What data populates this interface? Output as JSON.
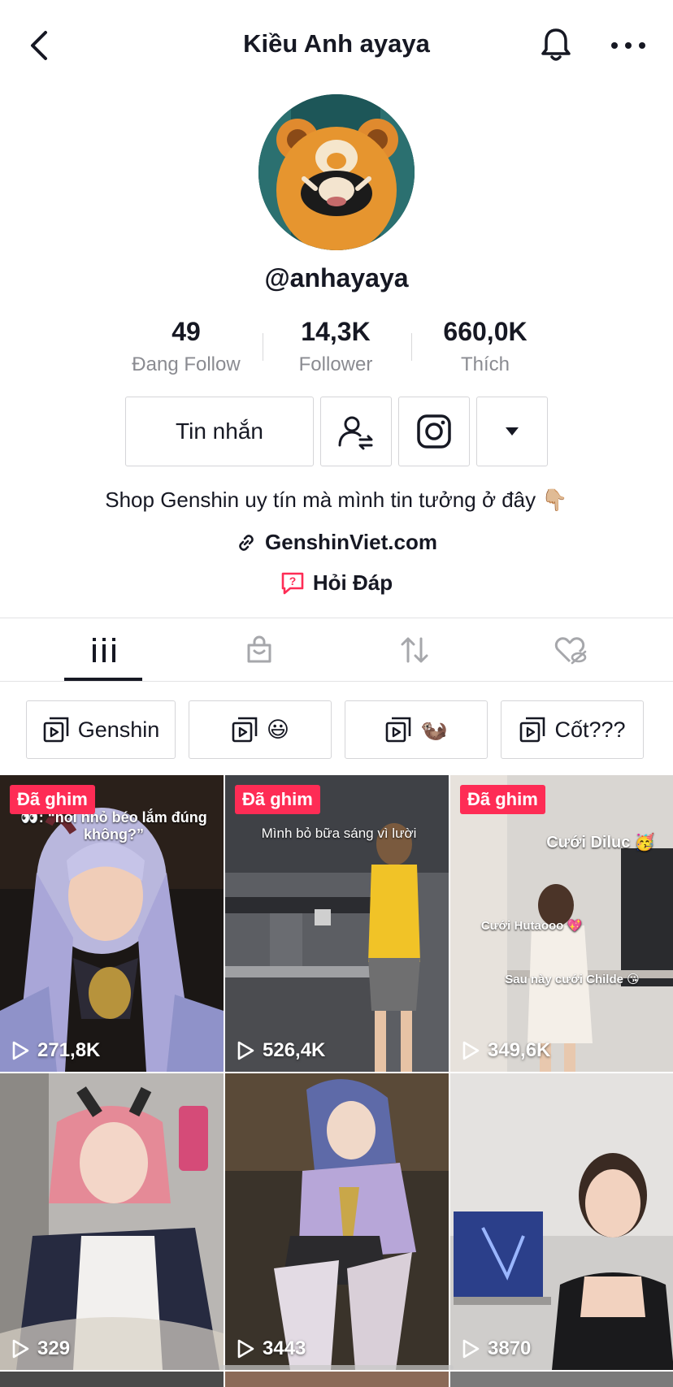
{
  "header": {
    "title": "Kiều Anh ayaya",
    "back_icon": "chevron-left-icon",
    "bell_icon": "bell-icon",
    "more_icon": "more-horizontal-icon"
  },
  "profile": {
    "handle": "@anhayaya",
    "stats": [
      {
        "value": "49",
        "label": "Đang Follow"
      },
      {
        "value": "14,3K",
        "label": "Follower"
      },
      {
        "value": "660,0K",
        "label": "Thích"
      }
    ],
    "message_button": "Tin nhắn",
    "bio": "Shop Genshin uy tín mà mình tin tưởng ở đây 👇🏼",
    "link": "GenshinViet.com",
    "qa": "Hỏi Đáp"
  },
  "tabs": [
    {
      "name": "videos",
      "icon": "grid-bars-icon",
      "active": true
    },
    {
      "name": "shop",
      "icon": "shopping-bag-icon",
      "active": false
    },
    {
      "name": "reposts",
      "icon": "repost-icon",
      "active": false
    },
    {
      "name": "liked",
      "icon": "hidden-heart-icon",
      "active": false
    }
  ],
  "playlists": [
    {
      "label": "Genshin"
    },
    {
      "label": "😃"
    },
    {
      "label": "🦦"
    },
    {
      "label": "Cốt???"
    }
  ],
  "pinned_label": "Đã ghim",
  "videos": [
    {
      "views": "271,8K",
      "pinned": true,
      "caption": "👀: “hồi nhỏ béo lắm đúng không?”"
    },
    {
      "views": "526,4K",
      "pinned": true,
      "caption": "Mình bỏ bữa sáng vì lười"
    },
    {
      "views": "349,6K",
      "pinned": true,
      "caption": "Cưới Diluc 🥳",
      "caption2": "Cưới Hutaooo 💖",
      "caption3": "Sau này cưới Childe 😘"
    },
    {
      "views": "329",
      "pinned": false
    },
    {
      "views": "3443",
      "pinned": false
    },
    {
      "views": "3870",
      "pinned": false
    }
  ],
  "colors": {
    "accent": "#fe2c55",
    "text": "#161823",
    "muted": "#8a8b91"
  }
}
